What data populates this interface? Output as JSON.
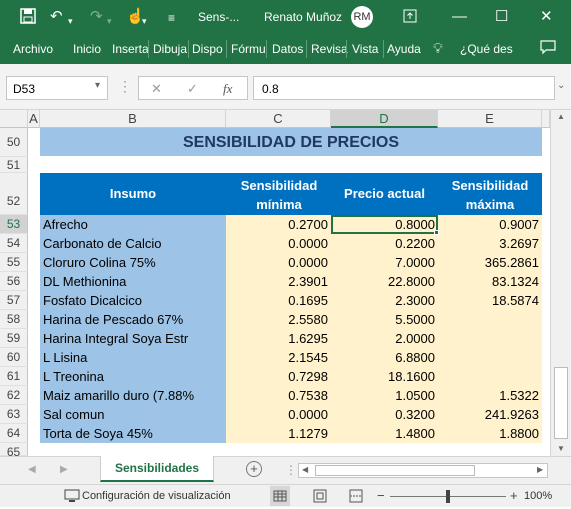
{
  "titlebar": {
    "file_name": "Sens-...",
    "user_name": "Renato Muñoz",
    "avatar_text": "RM"
  },
  "ribbon": {
    "tabs": [
      "Archivo",
      "Inicio",
      "Inserta",
      "Dibuja",
      "Dispo",
      "Fórmu",
      "Datos",
      "Revisa",
      "Vista",
      "Ayuda"
    ],
    "tell_me": "¿Qué des"
  },
  "formula_bar": {
    "name_box": "D53",
    "fx_label": "fx",
    "value": "0.8"
  },
  "columns": [
    "A",
    "B",
    "C",
    "D",
    "E"
  ],
  "sheet": {
    "title": "SENSIBILIDAD DE PRECIOS",
    "headers": {
      "insumo": "Insumo",
      "sens_min": "Sensibilidad mínima",
      "precio": "Precio actual",
      "sens_max": "Sensibilidad máxima"
    },
    "row_numbers": [
      "50",
      "51",
      "52",
      "53",
      "54",
      "55",
      "56",
      "57",
      "58",
      "59",
      "60",
      "61",
      "62",
      "63",
      "64",
      "65"
    ],
    "rows": [
      {
        "insumo": "Afrecho",
        "min": "0.2700",
        "precio": "0.8000",
        "max": "0.9007"
      },
      {
        "insumo": "Carbonato de Calcio",
        "min": "0.0000",
        "precio": "0.2200",
        "max": "3.2697"
      },
      {
        "insumo": "Cloruro Colina 75%",
        "min": "0.0000",
        "precio": "7.0000",
        "max": "365.2861"
      },
      {
        "insumo": "DL Methionina",
        "min": "2.3901",
        "precio": "22.8000",
        "max": "83.1324"
      },
      {
        "insumo": "Fosfato Dicalcico",
        "min": "0.1695",
        "precio": "2.3000",
        "max": "18.5874"
      },
      {
        "insumo": "Harina de Pescado 67%",
        "min": "2.5580",
        "precio": "5.5000",
        "max": ""
      },
      {
        "insumo": "Harina Integral Soya Estr",
        "min": "1.6295",
        "precio": "2.0000",
        "max": ""
      },
      {
        "insumo": "L Lisina",
        "min": "2.1545",
        "precio": "6.8800",
        "max": ""
      },
      {
        "insumo": "L Treonina",
        "min": "0.7298",
        "precio": "18.1600",
        "max": ""
      },
      {
        "insumo": "Maiz amarillo duro (7.88%",
        "min": "0.7538",
        "precio": "1.0500",
        "max": "1.5322"
      },
      {
        "insumo": "Sal comun",
        "min": "0.0000",
        "precio": "0.3200",
        "max": "241.9263"
      },
      {
        "insumo": "Torta de Soya 45%",
        "min": "1.1279",
        "precio": "1.4800",
        "max": "1.8800"
      }
    ]
  },
  "sheet_tabs": [
    "Sensibilidades"
  ],
  "status_bar": {
    "view_settings": "Configuración de visualización",
    "zoom": "100%"
  },
  "colors": {
    "excel_green": "#217346",
    "header_blue": "#0070c0",
    "light_blue": "#9dc3e6",
    "cream": "#fff2cc"
  }
}
